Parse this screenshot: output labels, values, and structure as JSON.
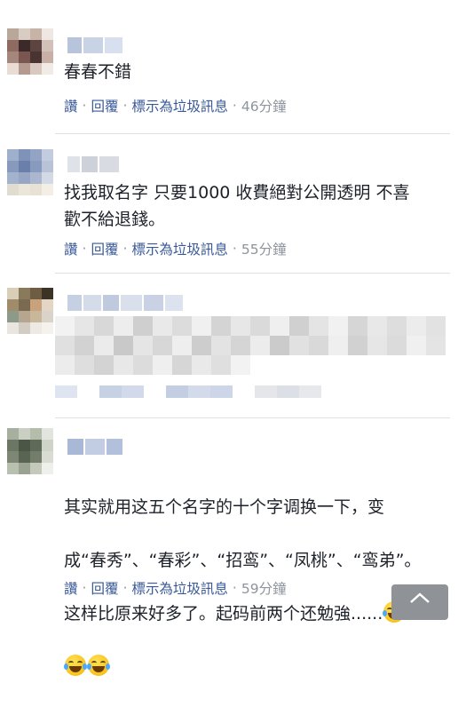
{
  "actions": {
    "like": "讚",
    "reply": "回覆",
    "spam": "標示為垃圾訊息",
    "separator": "·"
  },
  "comments": [
    {
      "text": "春春不錯",
      "time": "46分鐘"
    },
    {
      "text": "找我取名字 只要1000 收費絕對公開透明 不喜\n歡不給退錢。",
      "time": "55分鐘"
    },
    {
      "text": "",
      "time": ""
    },
    {
      "text_line1": "其实就用这五个名字的十个字调换一下，变",
      "text_line2": "成“春秀”、“春彩”、“招鸾”、“凤桃”、“鸾弟”。",
      "text_line3": "这样比原来好多了。起码前两个还勉強......",
      "emoji": "face-with-tears-of-joy-icon",
      "time": "59分鐘"
    }
  ],
  "colors": {
    "link": "#385898",
    "muted": "#8d949e",
    "text": "#1d2129"
  }
}
